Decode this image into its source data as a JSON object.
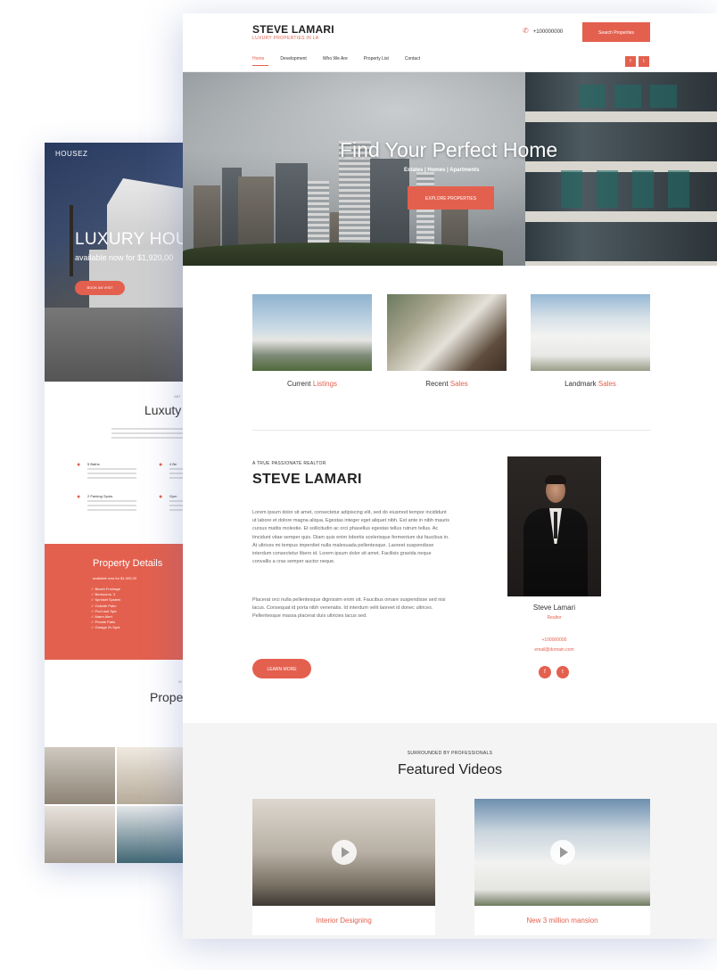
{
  "back_page": {
    "logo": "HOUSEZ",
    "hero_title": "LUXURY HOUS",
    "hero_subtitle": "available now for $1,920,00",
    "hero_button": "BOOK AN VISIT",
    "section_eyebrow": "ABT",
    "section_heading": "Luxuty",
    "features": [
      {
        "icon": "bed-icon",
        "label": "5 Baths"
      },
      {
        "icon": "bed-icon",
        "label": "4 Be"
      },
      {
        "icon": "car-icon",
        "label": "2 Parking Spots"
      },
      {
        "icon": "pin-icon",
        "label": "Gym"
      }
    ],
    "details_title": "Property Details",
    "details_subtitle": "available now for $1,920,00",
    "details_list": [
      "Beach Frontage",
      "Bedrooms: 3",
      "Sprinkel System",
      "Outside Patio",
      "Pool and Spa",
      "Alarm Alert",
      "Private Patio",
      "Garage 2x Spot"
    ],
    "prop_eyebrow": "W",
    "prop_heading": "Prope"
  },
  "header": {
    "brand": "STEVE LAMARI",
    "tagline": "LUXURY PROPERTIES IN LA",
    "phone": "+100000000",
    "search_button": "Search Properties",
    "nav": [
      "Home",
      "Development",
      "Who We Are",
      "Property List",
      "Contact"
    ],
    "social": [
      "f",
      "t"
    ]
  },
  "hero": {
    "title": "Find Your Perfect Home",
    "subtitle": "Estates  |  Homes  |  Apartments",
    "button": "EXPLORE PROPERTIES"
  },
  "listings": [
    {
      "word": "Current",
      "highlight": "Listings"
    },
    {
      "word": "Recent",
      "highlight": "Sales"
    },
    {
      "word": "Landmark",
      "highlight": "Sales"
    }
  ],
  "agent": {
    "eyebrow": "A TRUE PASSIONATE REALTOR",
    "name": "STEVE LAMARI",
    "paragraph1": "Lorem ipsum dolor sit amet, consectetur adipiscing elit, sed do eiusmod tempor incididunt ut labore et dolore magna aliqua. Egestas integer eget aliquet nibh. Est ante in nibh mauris cursus mattis molestie. Et sollicitudin ac orci phasellus egestas tellus rutrum tellus. Ac tincidunt vitae semper quis. Diam quis enim lobortis scelerisque fermentum dui faucibus in. At ultrices mi tempus imperdiet nulla malesuada pellentesque. Laoreet suspendisse interdum consectetur libero id. Lorem ipsum dolor sit amet. Facilisis gravida neque convallis a cras semper auctor neque.",
    "paragraph2": "Placerat orci nulla pellentesque dignissim enim sit. Faucibus ornare suspendisse sed nisi lacus. Consequat id porta nibh venenatis. Id interdum velit laoreet id donec ultrices. Pellentesque massa placerat duis ultricies lacus sed.",
    "button": "LEARN MORE",
    "card_name": "Steve Lamari",
    "card_role": "Realtor",
    "card_phone": "+100000000",
    "card_email": "email@domain.com",
    "social": [
      "f",
      "t"
    ]
  },
  "videos": {
    "eyebrow": "SURROUNDED BY PROFESSIONALS",
    "title": "Featured Videos",
    "items": [
      {
        "caption": "Interior Designing"
      },
      {
        "caption": "New 3 million mansion"
      }
    ]
  },
  "colors": {
    "accent": "#e4604e"
  }
}
